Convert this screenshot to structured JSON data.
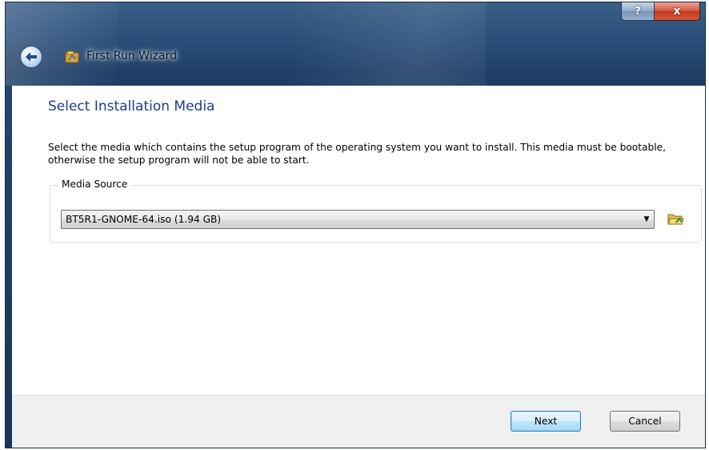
{
  "window": {
    "title": "First Run Wizard",
    "help_label": "?",
    "close_label": "x",
    "back_icon": "back-arrow-icon",
    "app_icon": "virtualbox-wizard-icon"
  },
  "page": {
    "heading": "Select Installation Media",
    "description": "Select the media which contains the setup program of the operating system you want to install. This media must be bootable, otherwise the setup program will not be able to start."
  },
  "media_source": {
    "group_label": "Media Source",
    "selected": "BT5R1-GNOME-64.iso (1.94 GB)",
    "dropdown_icon": "chevron-down-icon",
    "browse_icon": "folder-open-icon"
  },
  "buttons": {
    "next_label": "Next",
    "cancel_label": "Cancel"
  },
  "colors": {
    "heading": "#1d3c8c",
    "aero_frame": "#1e3e66",
    "close_button": "#c13a22"
  }
}
